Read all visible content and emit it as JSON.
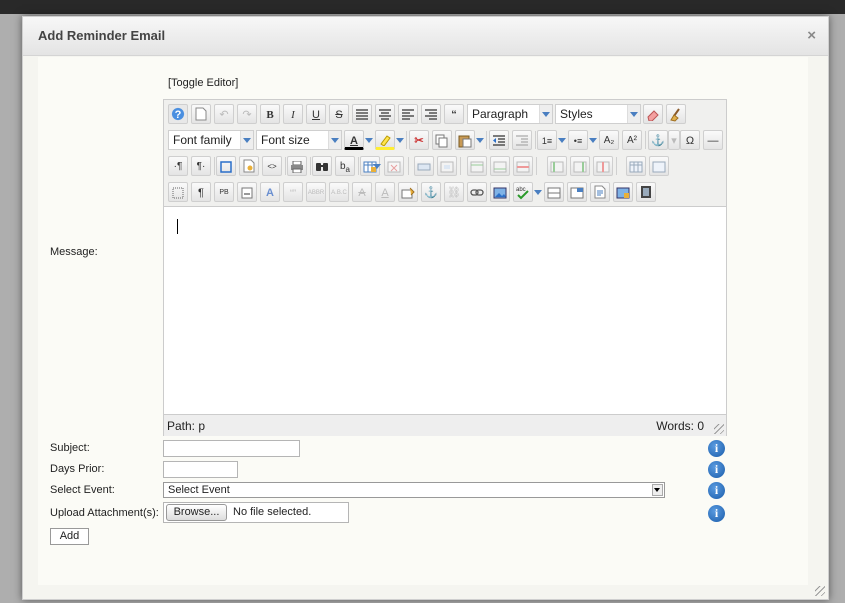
{
  "dialog": {
    "title": "Add Reminder Email",
    "close_label": "×"
  },
  "editor": {
    "toggle_label": "[Toggle Editor]",
    "format_select": "Paragraph",
    "styles_select": "Styles",
    "font_family_select": "Font family",
    "font_size_select": "Font size",
    "buttons": {
      "bold": "B",
      "italic": "I",
      "underline": "U",
      "strike": "S",
      "omega": "Ω",
      "subscript": "A₂",
      "superscript": "A²",
      "ltr": "·¶",
      "rtl": "¶·",
      "pilcrow": "¶"
    },
    "status": {
      "path": "Path:  p",
      "words": "Words: 0"
    }
  },
  "form": {
    "message_label": "Message:",
    "subject_label": "Subject:",
    "subject_value": "",
    "days_prior_label": "Days Prior:",
    "days_prior_value": "",
    "select_event_label": "Select Event:",
    "select_event_value": "Select Event",
    "upload_label": "Upload Attachment(s):",
    "browse_label": "Browse...",
    "no_file_text": "No file selected.",
    "add_label": "Add",
    "info_glyph": "i"
  },
  "icons": [
    "help-icon",
    "new-document-icon",
    "undo-icon",
    "redo-icon",
    "bold-icon",
    "italic-icon",
    "underline-icon",
    "strikethrough-icon",
    "align-justify-icon",
    "align-center-icon",
    "align-left-icon",
    "align-right-icon",
    "blockquote-icon",
    "eraser-icon",
    "cleanup-icon",
    "text-color-icon",
    "highlight-icon",
    "cut-icon",
    "copy-icon",
    "paste-icon",
    "outdent-icon",
    "indent-icon",
    "numbered-list-icon",
    "bullet-list-icon",
    "subscript-icon",
    "superscript-icon",
    "anchor-icon",
    "special-char-icon",
    "horizontal-rule-icon",
    "fullscreen-icon",
    "template-icon",
    "html-icon",
    "print-icon",
    "find-icon",
    "replace-icon",
    "table-icon",
    "visual-aid-icon",
    "image-icon",
    "media-icon",
    "spellcheck-icon",
    "info-icon"
  ]
}
